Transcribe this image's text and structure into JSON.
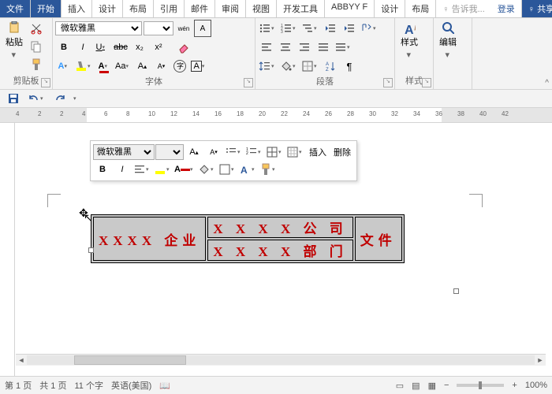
{
  "tabs": {
    "file": "文件",
    "home": "开始",
    "insert": "插入",
    "design": "设计",
    "layout": "布局",
    "references": "引用",
    "mailings": "邮件",
    "review": "审阅",
    "view": "视图",
    "dev": "开发工具",
    "abbyy": "ABBYY F",
    "design2": "设计",
    "layout2": "布局",
    "tell_prefix": "♀",
    "tell": "告诉我...",
    "login": "登录",
    "share": "共享"
  },
  "ribbon": {
    "font_name": "微软雅黑",
    "font_size": "",
    "clipboard": {
      "title": "剪贴板",
      "paste": "粘贴"
    },
    "font": {
      "title": "字体",
      "bold": "B",
      "italic": "I",
      "underline": "U",
      "strike": "abc",
      "sub": "x₂",
      "sup": "x²",
      "phonetic": "wén",
      "charborder": "A",
      "clearfmt": "◆"
    },
    "para": {
      "title": "段落"
    },
    "styles": {
      "title": "样式",
      "label": "样式"
    },
    "editing": {
      "title": "编辑",
      "label": "编辑"
    }
  },
  "ruler": {
    "marks": [
      -4,
      -2,
      2,
      4,
      6,
      8,
      10,
      12,
      14,
      16,
      18,
      20,
      22,
      24,
      26,
      28,
      30,
      32,
      34,
      36,
      38,
      40,
      42
    ]
  },
  "mini": {
    "font": "微软雅黑",
    "size": "",
    "insert": "插入",
    "delete": "删除",
    "bold": "B",
    "italic": "I"
  },
  "doc": {
    "c1": "XXXX 企业",
    "r1": "X X X X 公 司",
    "r2": "X X X X 部 门",
    "c3": "文件"
  },
  "status": {
    "page": "第 1 页",
    "pages": "共 1 页",
    "words": "11 个字",
    "lang": "英语(美国)",
    "zoom": "100%"
  }
}
